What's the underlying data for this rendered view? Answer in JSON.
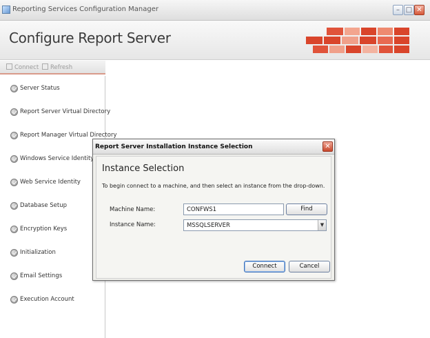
{
  "window": {
    "title": "Reporting Services Configuration Manager",
    "page_title": "Configure Report Server"
  },
  "toolbar": {
    "connect_label": "Connect",
    "refresh_label": "Refresh"
  },
  "sidebar": {
    "items": [
      {
        "label": "Server Status"
      },
      {
        "label": "Report Server Virtual Directory"
      },
      {
        "label": "Report Manager Virtual Directory"
      },
      {
        "label": "Windows Service Identity"
      },
      {
        "label": "Web Service Identity"
      },
      {
        "label": "Database Setup"
      },
      {
        "label": "Encryption Keys"
      },
      {
        "label": "Initialization"
      },
      {
        "label": "Email Settings"
      },
      {
        "label": "Execution Account"
      }
    ]
  },
  "dialog": {
    "title": "Report Server Installation Instance Selection",
    "heading": "Instance Selection",
    "description": "To begin connect to a machine, and then select an instance from the drop-down.",
    "machine_label": "Machine Name:",
    "machine_value": "CONFWS1",
    "instance_label": "Instance Name:",
    "instance_value": "MSSQLSERVER",
    "find_label": "Find",
    "connect_label": "Connect",
    "cancel_label": "Cancel"
  },
  "colors": {
    "logo_dark": "#d9452b",
    "logo_light": "#f0a08a",
    "toolbar_accent": "#d99a8a"
  }
}
